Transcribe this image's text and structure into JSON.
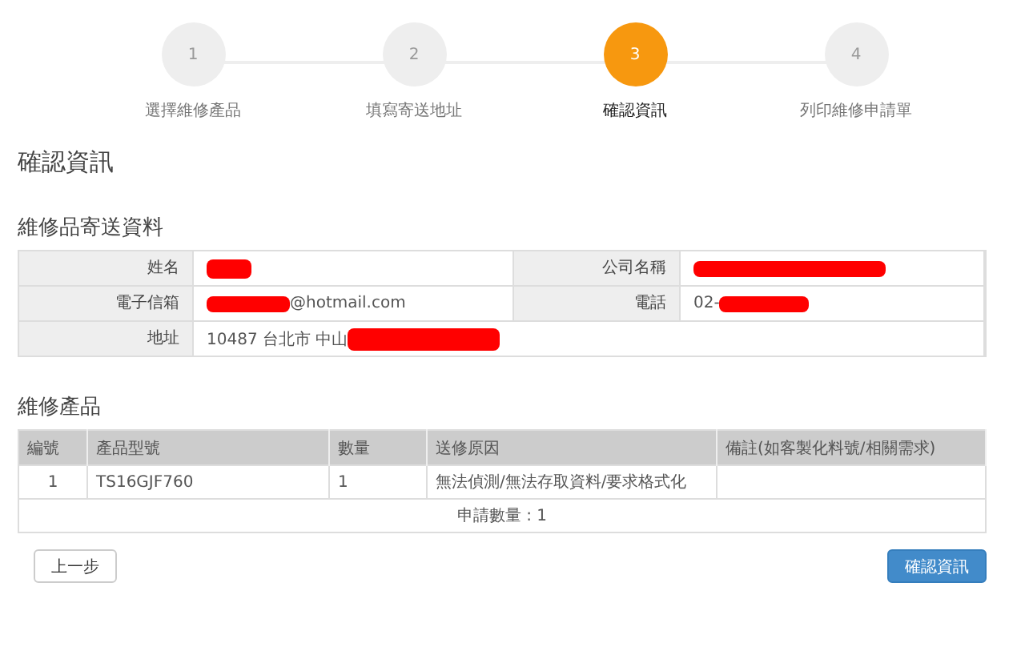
{
  "steps": [
    {
      "number": "1",
      "label": "選擇維修產品",
      "selected": false
    },
    {
      "number": "2",
      "label": "填寫寄送地址",
      "selected": false
    },
    {
      "number": "3",
      "label": "確認資訊",
      "selected": true
    },
    {
      "number": "4",
      "label": "列印維修申請單",
      "selected": false
    }
  ],
  "page_title": "確認資訊",
  "shipping": {
    "title": "維修品寄送資料",
    "rows": [
      [
        {
          "label": "姓名",
          "redacted": true
        },
        {
          "label": "公司名稱",
          "redacted": true
        }
      ],
      [
        {
          "label": "電子信箱",
          "value": "@hotmail.com",
          "redacted": true
        },
        {
          "label": "電話",
          "value": "02-",
          "redacted": true
        }
      ],
      [
        {
          "label": "地址",
          "value": "10487 台北市 中山",
          "redacted": true
        }
      ]
    ]
  },
  "products": {
    "title": "維修產品",
    "columns": [
      "編號",
      "產品型號",
      "數量",
      "送修原因",
      "備註(如客製化料號/相關需求)"
    ],
    "rows": [
      [
        "1",
        "TS16GJF760",
        "1",
        "無法偵測/無法存取資料/要求格式化",
        ""
      ]
    ],
    "footer": "申請數量 : 1"
  },
  "buttons": [
    {
      "label": "上一步",
      "kind": "default"
    },
    {
      "label": "確認資訊",
      "kind": "primary"
    }
  ]
}
